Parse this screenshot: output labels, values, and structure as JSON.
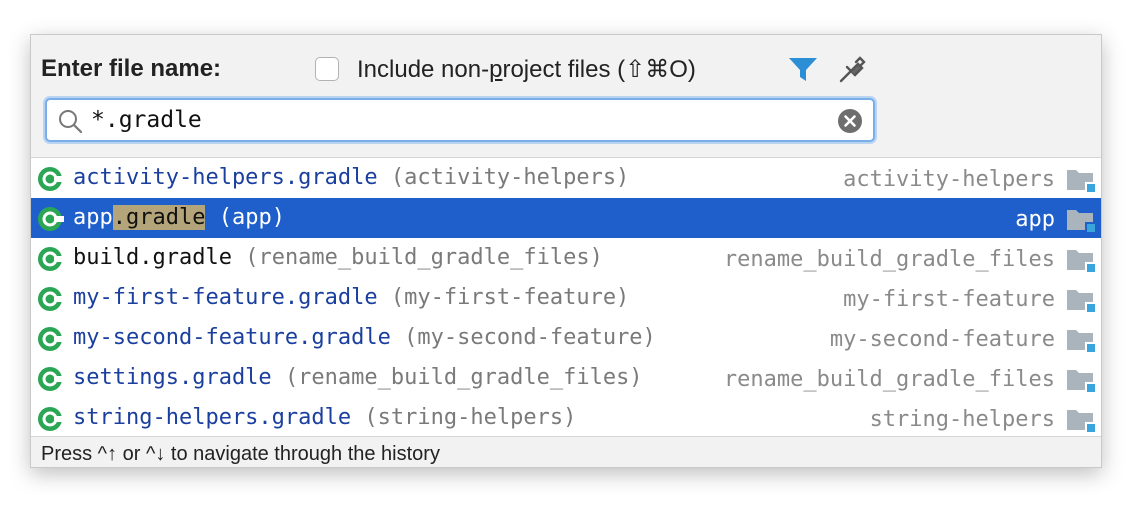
{
  "header": {
    "title": "Enter file name:",
    "checkbox": {
      "label_before": "Include non-",
      "label_underlined": "p",
      "label_after": "roject files (⇧⌘O)",
      "checked": false
    },
    "filter_icon": "filter-icon",
    "pin_icon": "pin-icon"
  },
  "search": {
    "value": "*.gradle",
    "icon": "search-icon",
    "clear_icon": "clear-icon"
  },
  "results": [
    {
      "filename": "activity-helpers.gradle",
      "module": "(activity-helpers)",
      "location": "activity-helpers",
      "selected": false
    },
    {
      "filename_prefix": "app",
      "filename_match": ".gradle",
      "module": "(app)",
      "location": "app",
      "selected": true
    },
    {
      "filename": "build.gradle",
      "module": "(rename_build_gradle_files)",
      "location": "rename_build_gradle_files",
      "selected": false
    },
    {
      "filename": "my-first-feature.gradle",
      "module": "(my-first-feature)",
      "location": "my-first-feature",
      "selected": false
    },
    {
      "filename": "my-second-feature.gradle",
      "module": "(my-second-feature)",
      "location": "my-second-feature",
      "selected": false
    },
    {
      "filename": "settings.gradle",
      "module": "(rename_build_gradle_files)",
      "location": "rename_build_gradle_files",
      "selected": false
    },
    {
      "filename": "string-helpers.gradle",
      "module": "(string-helpers)",
      "location": "string-helpers",
      "selected": false
    }
  ],
  "footer": {
    "hint": "Press ^↑ or ^↓ to navigate through the history"
  },
  "colors": {
    "selection": "#1f5fcb",
    "filename": "#1a3f9e",
    "match_highlight": "#b3a479",
    "gradle_icon": "#2aa655",
    "folder": "#a9b4bd",
    "folder_badge": "#3aa4dc"
  }
}
